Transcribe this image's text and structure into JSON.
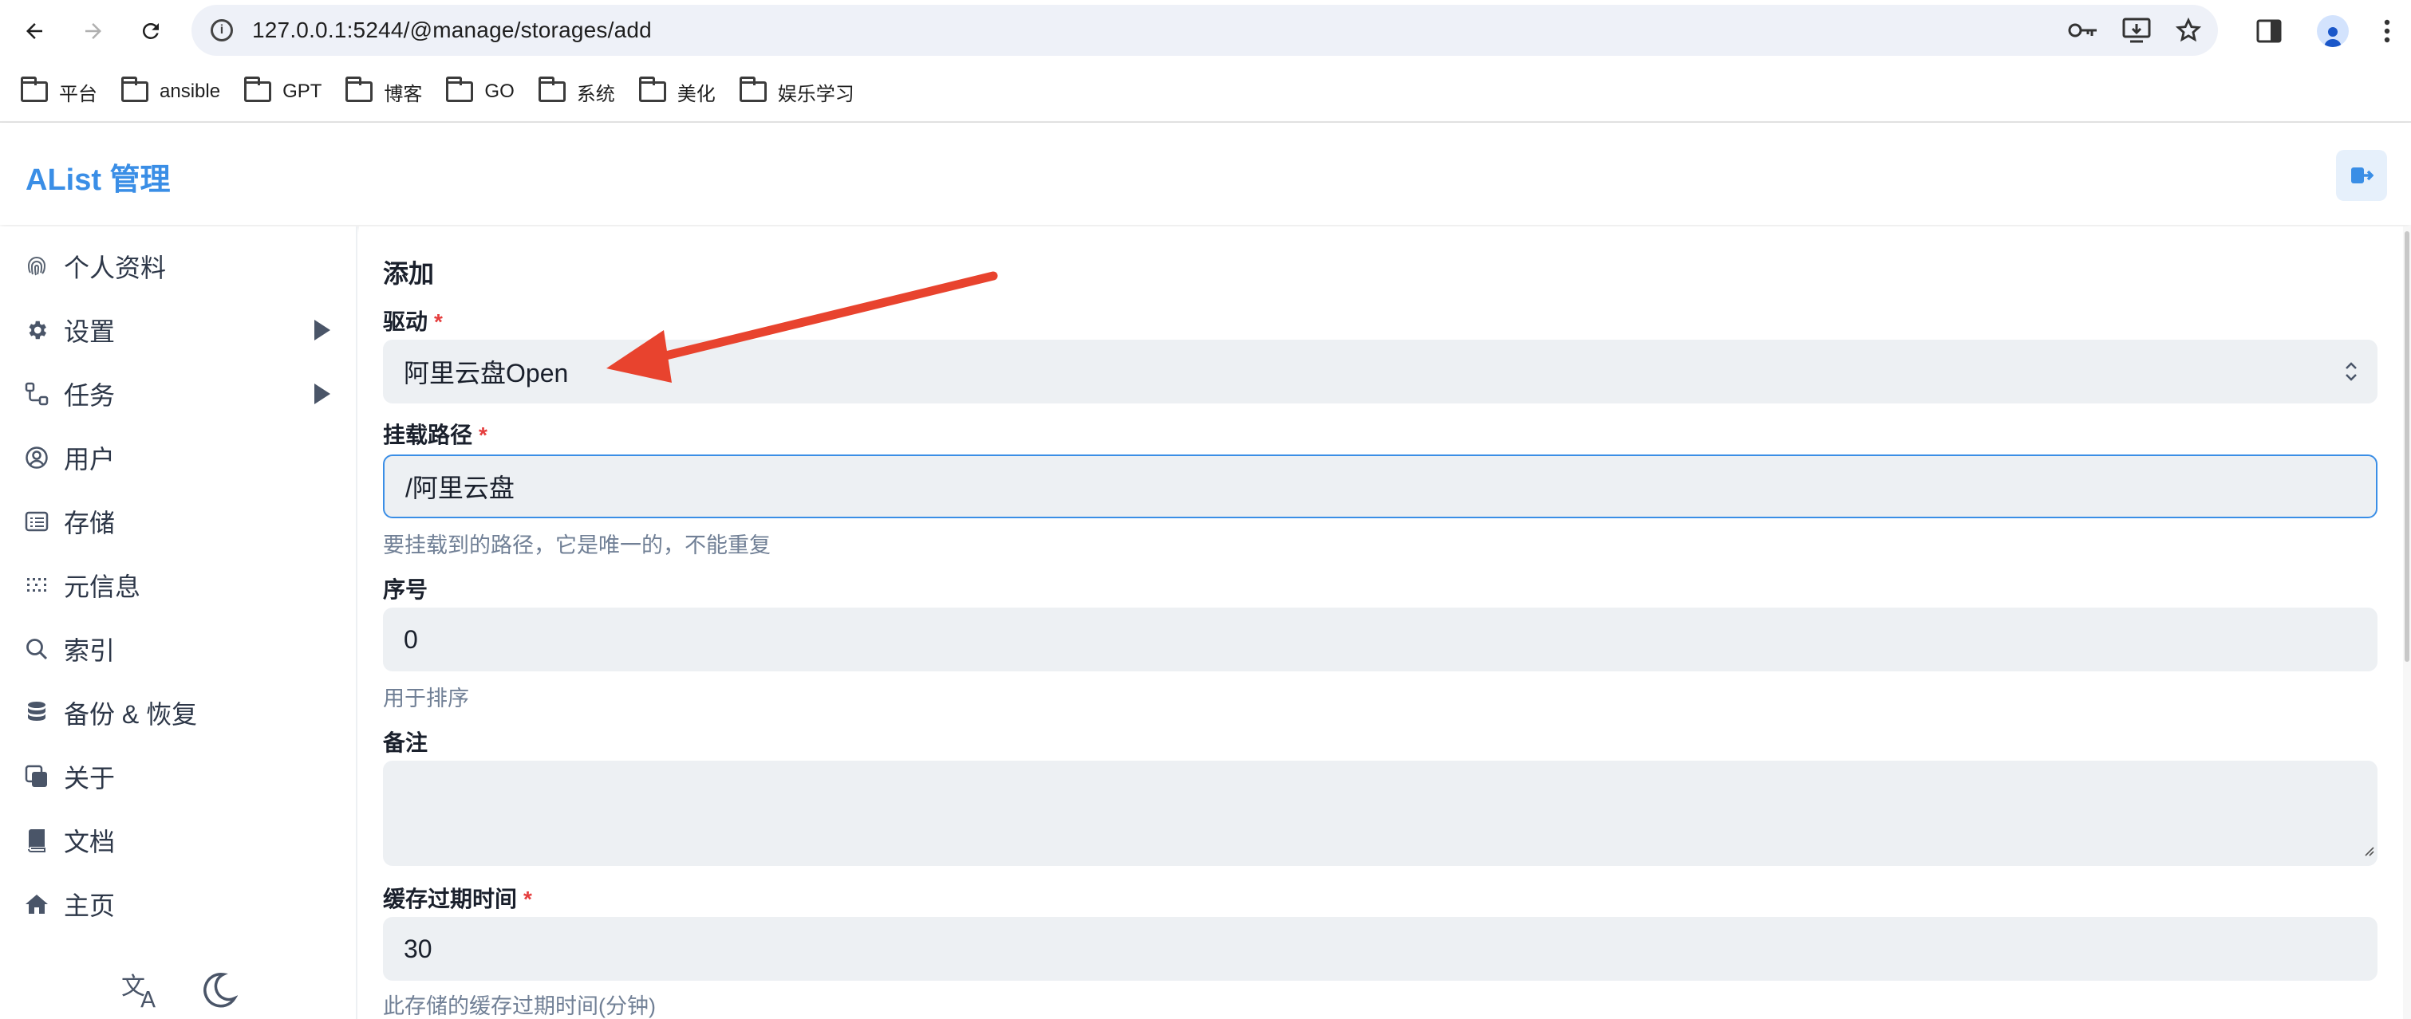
{
  "browser": {
    "url": "127.0.0.1:5244/@manage/storages/add",
    "bookmarks": [
      "平台",
      "ansible",
      "GPT",
      "博客",
      "GO",
      "系统",
      "美化",
      "娱乐学习"
    ]
  },
  "app": {
    "title": "AList 管理"
  },
  "sidebar": {
    "items": [
      {
        "label": "个人资料",
        "icon": "fingerprint-icon"
      },
      {
        "label": "设置",
        "icon": "gear-icon"
      },
      {
        "label": "任务",
        "icon": "workflow-icon"
      },
      {
        "label": "用户",
        "icon": "user-circle-icon"
      },
      {
        "label": "存储",
        "icon": "storage-icon"
      },
      {
        "label": "元信息",
        "icon": "grid-dots-icon"
      },
      {
        "label": "索引",
        "icon": "search-icon"
      },
      {
        "label": "备份 & 恢复",
        "icon": "database-icon"
      },
      {
        "label": "关于",
        "icon": "copy-icon"
      },
      {
        "label": "文档",
        "icon": "book-icon"
      },
      {
        "label": "主页",
        "icon": "home-icon"
      }
    ]
  },
  "form": {
    "title": "添加",
    "driver": {
      "label": "驱动",
      "value": "阿里云盘Open"
    },
    "mount_path": {
      "label": "挂载路径",
      "value": "/阿里云盘",
      "helper": "要挂载到的路径，它是唯一的，不能重复"
    },
    "order": {
      "label": "序号",
      "value": "0",
      "helper": "用于排序"
    },
    "remark": {
      "label": "备注",
      "value": ""
    },
    "cache_expiration": {
      "label": "缓存过期时间",
      "value": "30",
      "helper": "此存储的缓存过期时间(分钟)"
    }
  },
  "colors": {
    "accent": "#3a8ee6",
    "required": "#e53e3e",
    "annotation_arrow": "#e8432e"
  }
}
